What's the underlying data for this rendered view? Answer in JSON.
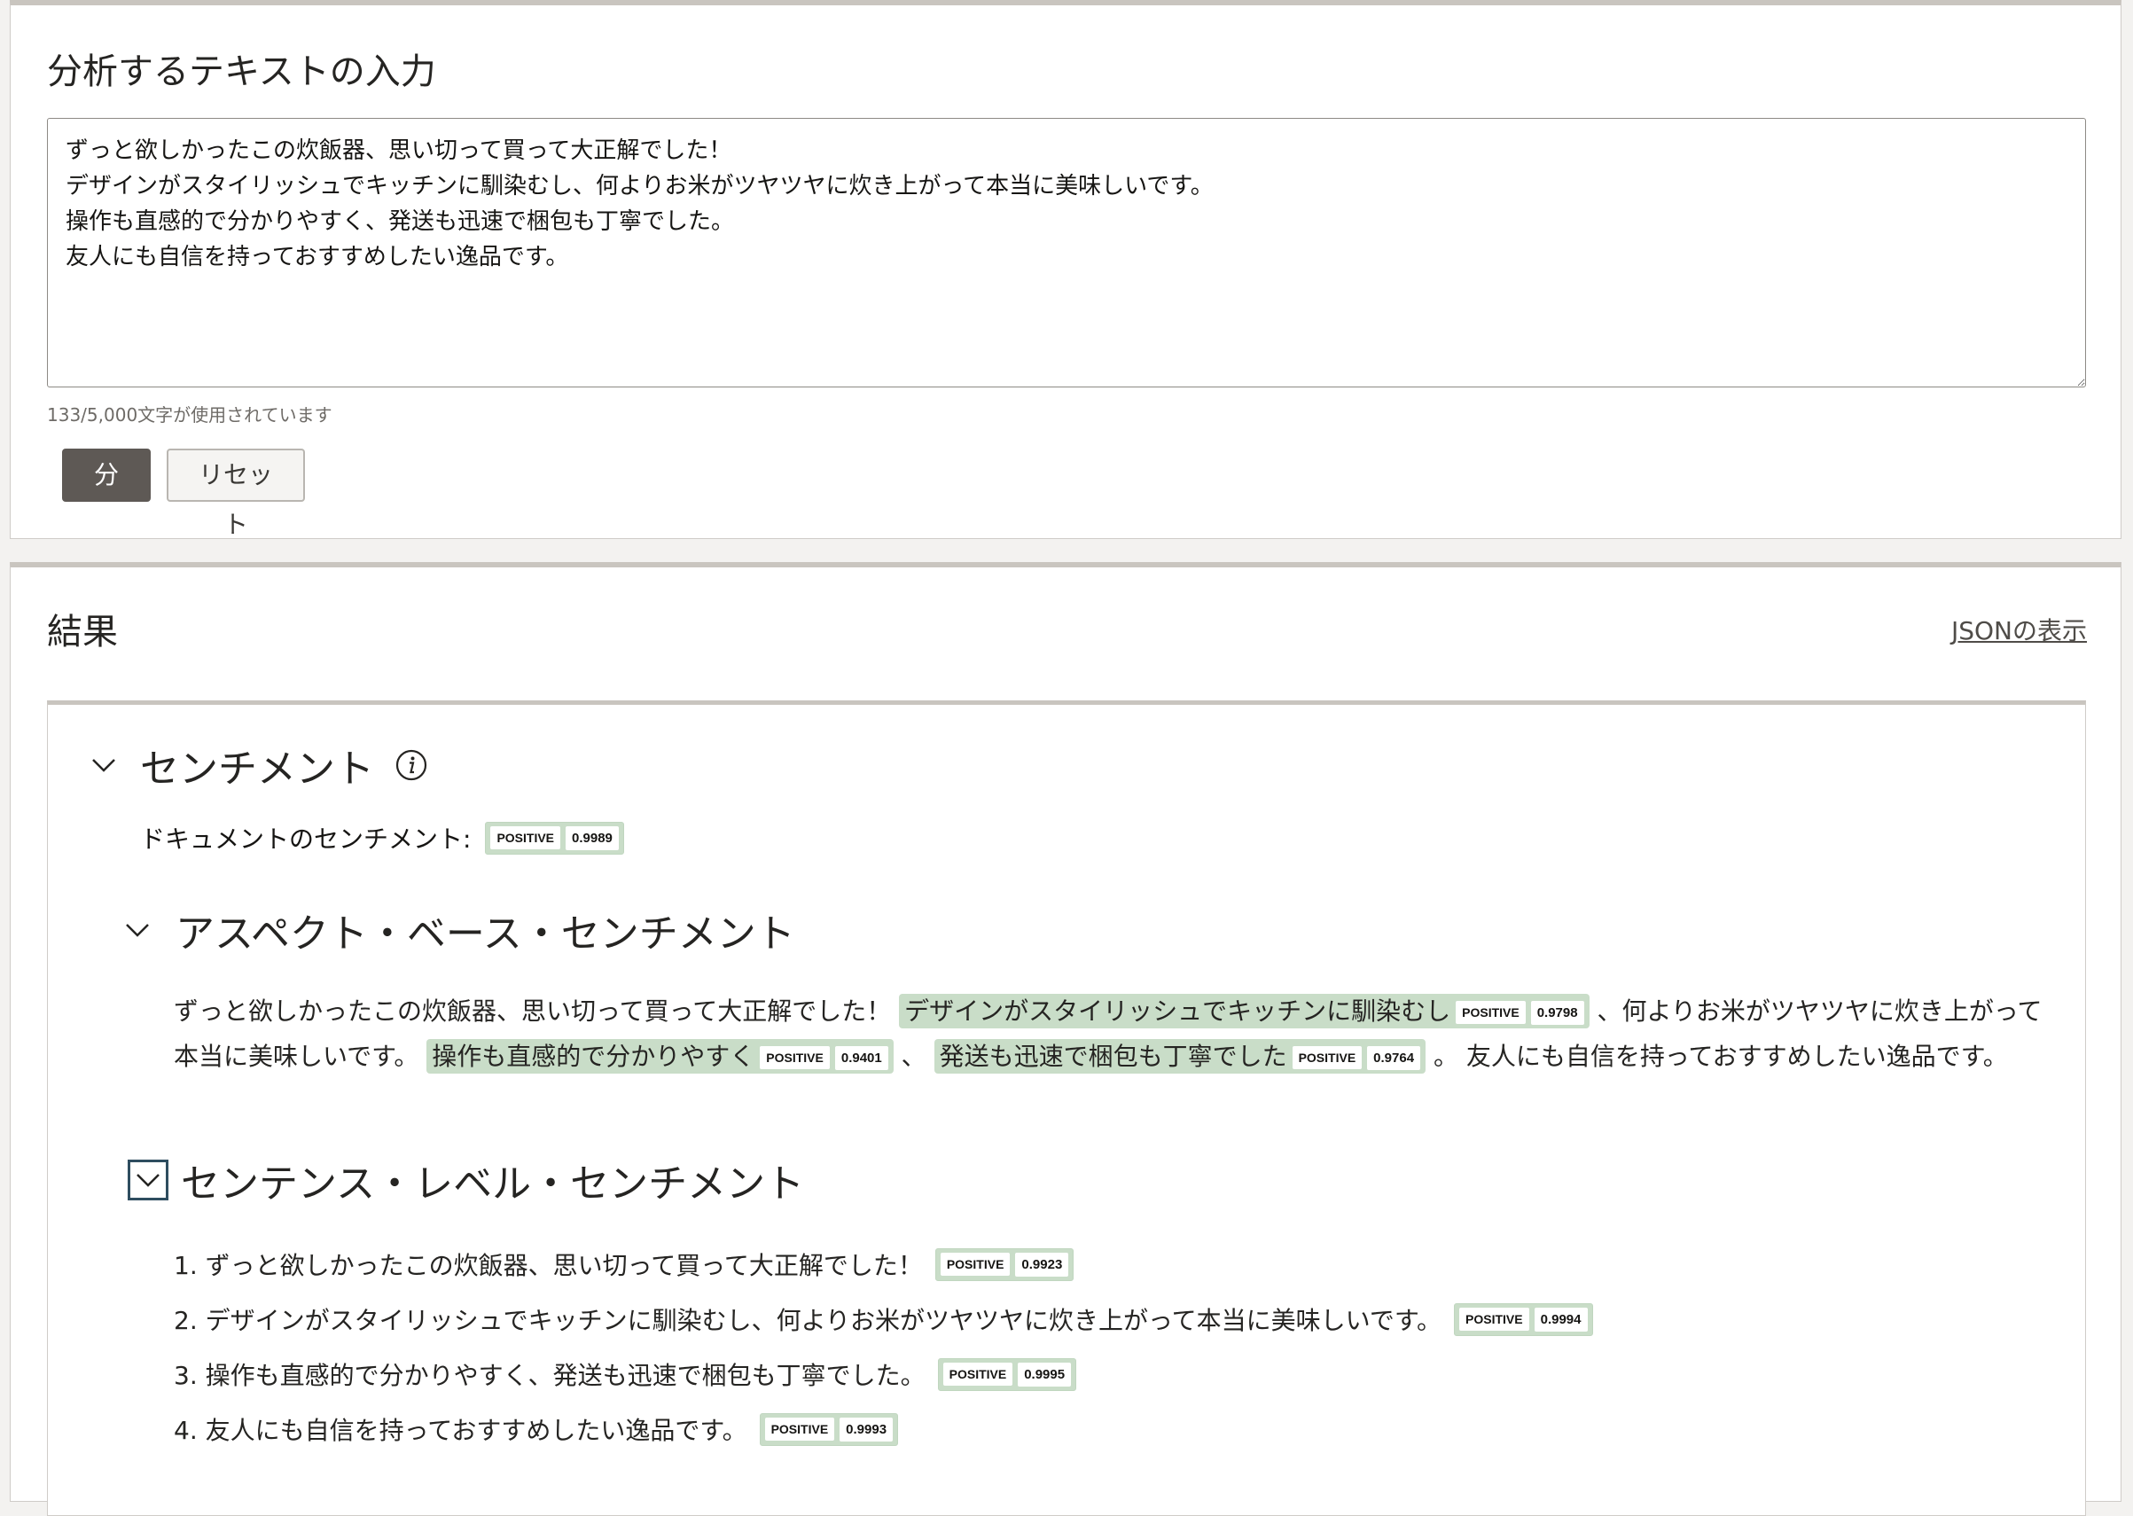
{
  "input_panel": {
    "title": "分析するテキストの入力",
    "text": "ずっと欲しかったこの炊飯器、思い切って買って大正解でした！\nデザインがスタイリッシュでキッチンに馴染むし、何よりお米がツヤツヤに炊き上がって本当に美味しいです。\n操作も直感的で分かりやすく、発送も迅速で梱包も丁寧でした。\n友人にも自信を持っておすすめしたい逸品です。",
    "char_count": "133/5,000文字が使用されています",
    "analyze_label": "分析",
    "reset_label": "リセット"
  },
  "result_panel": {
    "title": "結果",
    "json_link": "JSONの表示",
    "sentiment": {
      "title": "センチメント",
      "doc_label": "ドキュメントのセンチメント:",
      "doc_badge": {
        "label": "POSITIVE",
        "score": "0.9989"
      },
      "aspect": {
        "title": "アスペクト・ベース・センチメント",
        "segments": [
          {
            "text": "ずっと欲しかったこの炊飯器、思い切って買って大正解でした！ "
          },
          {
            "text": "デザインがスタイリッシュでキッチンに馴染むし",
            "label": "POSITIVE",
            "score": "0.9798"
          },
          {
            "text": " 、何よりお米がツヤツヤに炊き上がって本当に美味しいです。 "
          },
          {
            "text": "操作も直感的で分かりやすく",
            "label": "POSITIVE",
            "score": "0.9401"
          },
          {
            "text": " 、 "
          },
          {
            "text": "発送も迅速で梱包も丁寧でした",
            "label": "POSITIVE",
            "score": "0.9764"
          },
          {
            "text": " 。 友人にも自信を持っておすすめしたい逸品です。"
          }
        ]
      },
      "sentence": {
        "title": "センテンス・レベル・センチメント",
        "items": [
          {
            "text": "1. ずっと欲しかったこの炊飯器、思い切って買って大正解でした！",
            "label": "POSITIVE",
            "score": "0.9923"
          },
          {
            "text": "2. デザインがスタイリッシュでキッチンに馴染むし、何よりお米がツヤツヤに炊き上がって本当に美味しいです。",
            "label": "POSITIVE",
            "score": "0.9994"
          },
          {
            "text": "3. 操作も直感的で分かりやすく、発送も迅速で梱包も丁寧でした。",
            "label": "POSITIVE",
            "score": "0.9995"
          },
          {
            "text": "4. 友人にも自信を持っておすすめしたい逸品です。",
            "label": "POSITIVE",
            "score": "0.9993"
          }
        ]
      }
    }
  },
  "colors": {
    "positive_bg": "#c9ddc8",
    "button_dark": "#5e5955",
    "focus_border": "#2e4d5f"
  }
}
